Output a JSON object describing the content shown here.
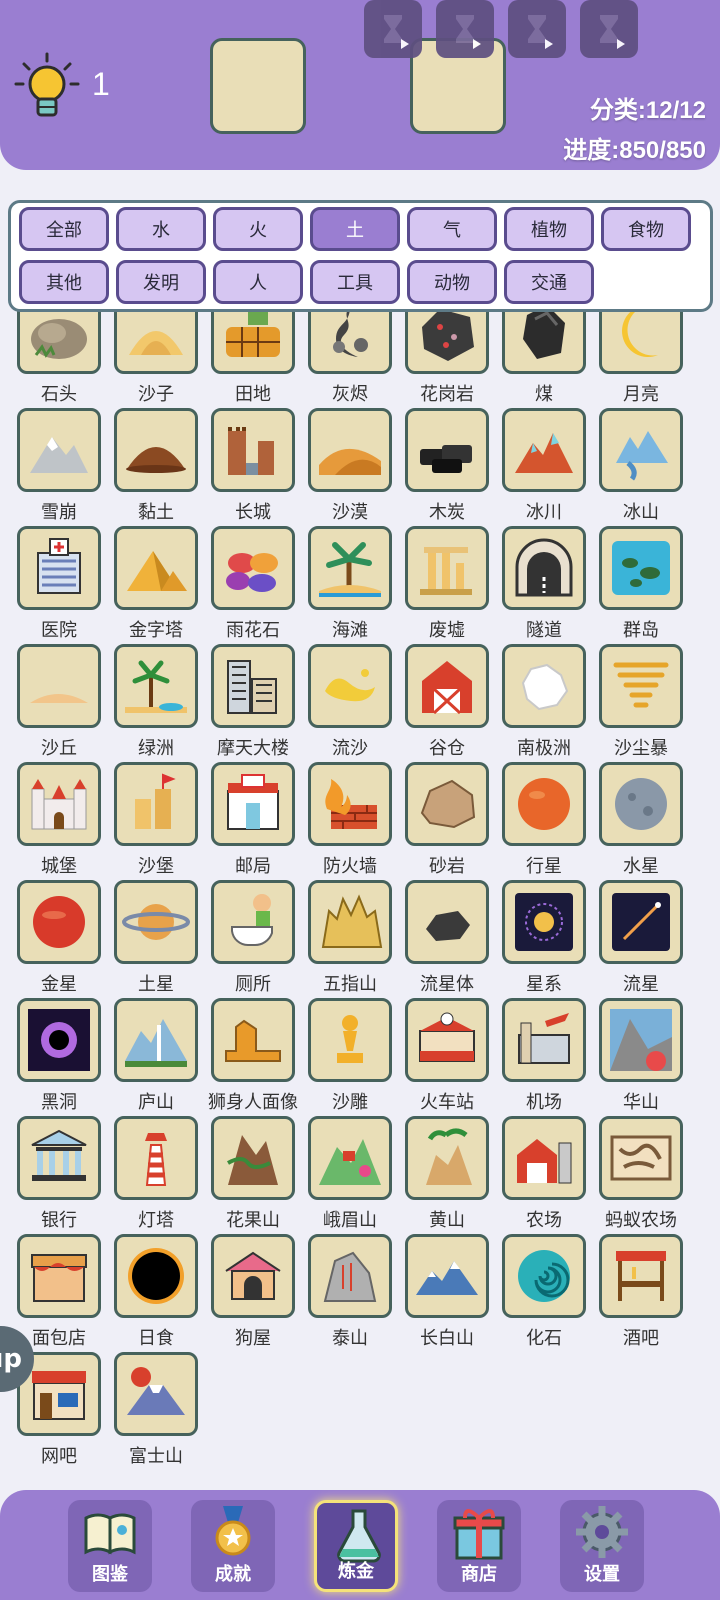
{
  "header": {
    "hint_count": "1",
    "category_progress": "分类:12/12",
    "progress": "进度:850/850"
  },
  "filters": [
    {
      "label": "全部",
      "active": false
    },
    {
      "label": "水",
      "active": false
    },
    {
      "label": "火",
      "active": false
    },
    {
      "label": "土",
      "active": true
    },
    {
      "label": "气",
      "active": false
    },
    {
      "label": "植物",
      "active": false
    },
    {
      "label": "食物",
      "active": false
    },
    {
      "label": "其他",
      "active": false
    },
    {
      "label": "发明",
      "active": false
    },
    {
      "label": "人",
      "active": false
    },
    {
      "label": "工具",
      "active": false
    },
    {
      "label": "动物",
      "active": false
    },
    {
      "label": "交通",
      "active": false
    }
  ],
  "elements": [
    {
      "label": "石头",
      "icon": "rock-icon"
    },
    {
      "label": "沙子",
      "icon": "sand-icon"
    },
    {
      "label": "田地",
      "icon": "field-icon"
    },
    {
      "label": "灰烬",
      "icon": "ash-icon"
    },
    {
      "label": "花岗岩",
      "icon": "granite-icon"
    },
    {
      "label": "煤",
      "icon": "coal-icon"
    },
    {
      "label": "月亮",
      "icon": "moon-icon"
    },
    {
      "label": "雪崩",
      "icon": "avalanche-icon"
    },
    {
      "label": "黏土",
      "icon": "clay-icon"
    },
    {
      "label": "长城",
      "icon": "great-wall-icon"
    },
    {
      "label": "沙漠",
      "icon": "desert-icon"
    },
    {
      "label": "木炭",
      "icon": "charcoal-icon"
    },
    {
      "label": "冰川",
      "icon": "glacier-icon"
    },
    {
      "label": "冰山",
      "icon": "iceberg-icon"
    },
    {
      "label": "医院",
      "icon": "hospital-icon"
    },
    {
      "label": "金字塔",
      "icon": "pyramid-icon"
    },
    {
      "label": "雨花石",
      "icon": "pebbles-icon"
    },
    {
      "label": "海滩",
      "icon": "beach-icon"
    },
    {
      "label": "废墟",
      "icon": "ruins-icon"
    },
    {
      "label": "隧道",
      "icon": "tunnel-icon"
    },
    {
      "label": "群岛",
      "icon": "archipelago-icon"
    },
    {
      "label": "沙丘",
      "icon": "dune-icon"
    },
    {
      "label": "绿洲",
      "icon": "oasis-icon"
    },
    {
      "label": "摩天大楼",
      "icon": "skyscraper-icon"
    },
    {
      "label": "流沙",
      "icon": "quicksand-icon"
    },
    {
      "label": "谷仓",
      "icon": "barn-icon"
    },
    {
      "label": "南极洲",
      "icon": "antarctica-icon"
    },
    {
      "label": "沙尘暴",
      "icon": "sandstorm-icon"
    },
    {
      "label": "城堡",
      "icon": "castle-icon"
    },
    {
      "label": "沙堡",
      "icon": "sandcastle-icon"
    },
    {
      "label": "邮局",
      "icon": "post-office-icon"
    },
    {
      "label": "防火墙",
      "icon": "firewall-icon"
    },
    {
      "label": "砂岩",
      "icon": "sandstone-icon"
    },
    {
      "label": "行星",
      "icon": "planet-icon"
    },
    {
      "label": "水星",
      "icon": "mercury-icon"
    },
    {
      "label": "金星",
      "icon": "venus-icon"
    },
    {
      "label": "土星",
      "icon": "saturn-icon"
    },
    {
      "label": "厕所",
      "icon": "toilet-icon"
    },
    {
      "label": "五指山",
      "icon": "five-finger-mountain-icon"
    },
    {
      "label": "流星体",
      "icon": "meteoroid-icon"
    },
    {
      "label": "星系",
      "icon": "galaxy-icon"
    },
    {
      "label": "流星",
      "icon": "meteor-icon"
    },
    {
      "label": "黑洞",
      "icon": "black-hole-icon"
    },
    {
      "label": "庐山",
      "icon": "lushan-icon"
    },
    {
      "label": "狮身人面像",
      "icon": "sphinx-icon"
    },
    {
      "label": "沙雕",
      "icon": "sand-sculpture-icon"
    },
    {
      "label": "火车站",
      "icon": "train-station-icon"
    },
    {
      "label": "机场",
      "icon": "airport-icon"
    },
    {
      "label": "华山",
      "icon": "huashan-icon"
    },
    {
      "label": "银行",
      "icon": "bank-icon"
    },
    {
      "label": "灯塔",
      "icon": "lighthouse-icon"
    },
    {
      "label": "花果山",
      "icon": "huaguoshan-icon"
    },
    {
      "label": "峨眉山",
      "icon": "emeishan-icon"
    },
    {
      "label": "黄山",
      "icon": "huangshan-icon"
    },
    {
      "label": "农场",
      "icon": "farm-icon"
    },
    {
      "label": "蚂蚁农场",
      "icon": "ant-farm-icon"
    },
    {
      "label": "面包店",
      "icon": "bakery-icon"
    },
    {
      "label": "日食",
      "icon": "eclipse-icon"
    },
    {
      "label": "狗屋",
      "icon": "doghouse-icon"
    },
    {
      "label": "泰山",
      "icon": "taishan-icon"
    },
    {
      "label": "长白山",
      "icon": "changbaishan-icon"
    },
    {
      "label": "化石",
      "icon": "fossil-icon"
    },
    {
      "label": "酒吧",
      "icon": "bar-icon"
    },
    {
      "label": "网吧",
      "icon": "internet-cafe-icon"
    },
    {
      "label": "富士山",
      "icon": "mount-fuji-icon"
    }
  ],
  "side_button": {
    "label": "ıp"
  },
  "nav": [
    {
      "label": "图鉴",
      "icon": "book-icon",
      "active": false
    },
    {
      "label": "成就",
      "icon": "medal-icon",
      "active": false
    },
    {
      "label": "炼金",
      "icon": "flask-icon",
      "active": true
    },
    {
      "label": "商店",
      "icon": "gift-icon",
      "active": false
    },
    {
      "label": "设置",
      "icon": "gear-icon",
      "active": false
    }
  ],
  "colors": {
    "header": "#9a7ed1",
    "tile": "#e9deb7",
    "tile_border": "#46625c",
    "filter_btn": "#d6c6f2"
  }
}
